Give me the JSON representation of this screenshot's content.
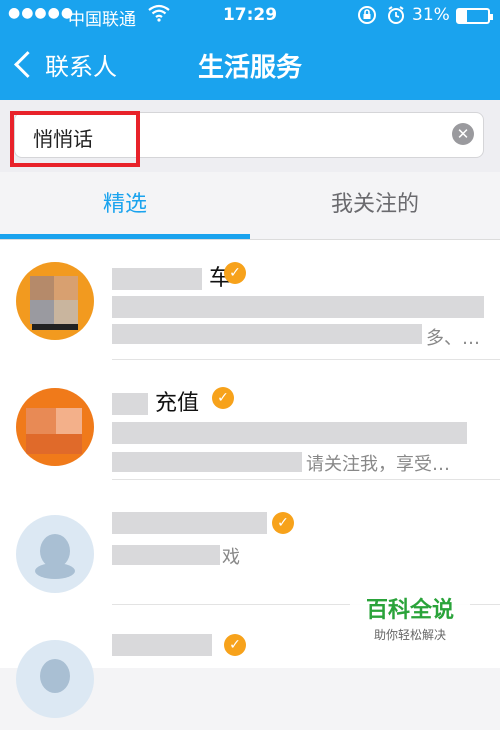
{
  "status_bar": {
    "signal": "●●●●●",
    "carrier": "中国联通",
    "time": "17:29",
    "battery_pct": "31%"
  },
  "nav": {
    "back_label": "联系人",
    "title": "生活服务"
  },
  "search": {
    "value": "悄悄话"
  },
  "tabs": [
    {
      "label": "精选",
      "selected": true
    },
    {
      "label": "我关注的",
      "selected": false
    }
  ],
  "list": {
    "items": [
      {
        "name_suffix": "车",
        "desc_suffix": "多、…"
      },
      {
        "name_suffix": "充值",
        "desc_suffix": "请关注我，享受…"
      },
      {
        "name_suffix": "",
        "desc_suffix": "戏"
      },
      {
        "name_suffix": "",
        "desc_suffix": ""
      }
    ]
  },
  "watermark": {
    "title": "百科全说",
    "subtitle": "助你轻松解决"
  },
  "colors": {
    "accent": "#1aa3ee",
    "highlight": "#e8222a",
    "verified_badge": "#f7a21b"
  }
}
